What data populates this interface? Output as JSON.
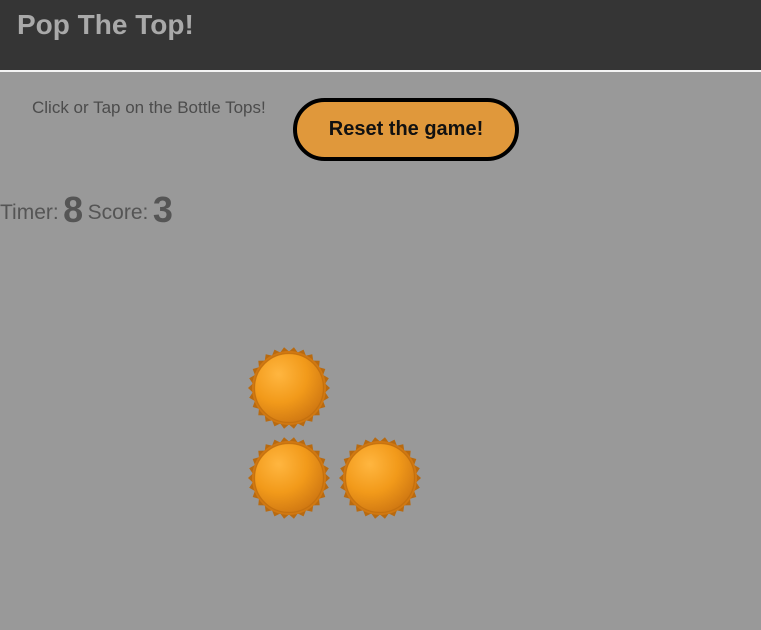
{
  "header": {
    "title": "Pop The Top!"
  },
  "controls": {
    "instructions": "Click or Tap on the Bottle Tops!",
    "reset_label": "Reset the game!"
  },
  "stats": {
    "timer_label": "Timer:",
    "timer_value": "8",
    "score_label": "Score:",
    "score_value": "3"
  },
  "bottle_caps": {
    "count": 3,
    "icon": "bottle-cap-icon",
    "colors": {
      "cap": "#f29a1a",
      "cap_dark": "#d07812",
      "ridge": "#b86a10"
    }
  },
  "colors": {
    "header_bg": "#353535",
    "page_bg": "#999999",
    "button_bg": "#e0983b"
  }
}
